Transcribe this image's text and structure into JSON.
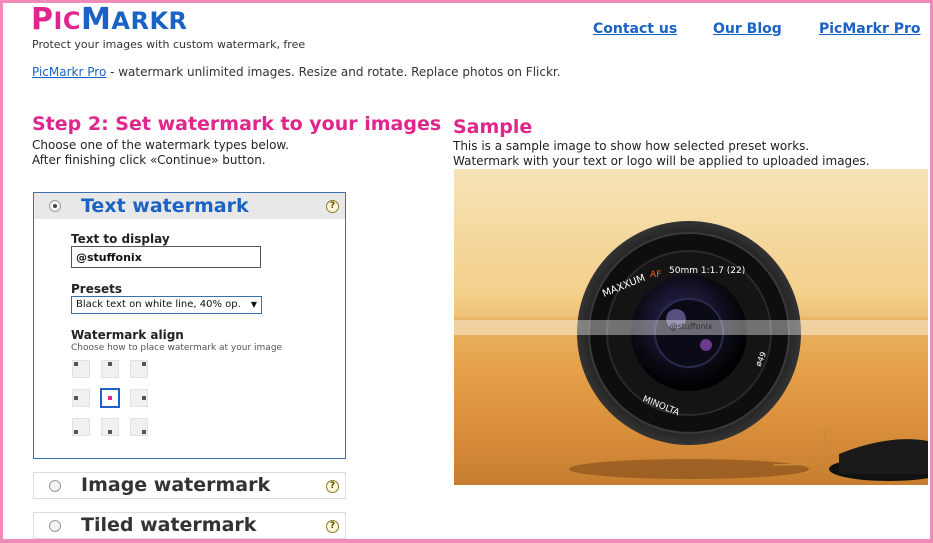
{
  "header": {
    "logo_first": "P",
    "logo_first_small": "IC",
    "logo_second": "M",
    "logo_second_small": "ARKR",
    "tagline": "Protect your images with custom watermark, free",
    "nav": [
      "Contact us",
      "Our Blog",
      "PicMarkr Pro"
    ]
  },
  "promo": {
    "link": "PicMarkr Pro",
    "text": " - watermark unlimited images. Resize and rotate. Replace photos on Flickr."
  },
  "step": {
    "title": "Step 2: Set watermark to your images",
    "line1": "Choose one of the watermark types below.",
    "line2": "After finishing click «Continue» button."
  },
  "text_watermark": {
    "title": "Text watermark",
    "help": "?",
    "text_label": "Text to display",
    "text_value": "@stuffonix",
    "presets_label": "Presets",
    "preset_selected": "Black text on white line, 40% op.",
    "align_label": "Watermark align",
    "align_hint": "Choose how to place watermark at your image",
    "selected_align": "middle-center"
  },
  "image_watermark": {
    "title": "Image watermark",
    "help": "?"
  },
  "tiled_watermark": {
    "title": "Tiled watermark",
    "help": "?"
  },
  "sample": {
    "title": "Sample",
    "line1": "This is a sample image to show how selected preset works.",
    "line2": "Watermark with your text or logo will be applied to uploaded images.",
    "watermark_text": "@stuffonix",
    "lens_text_1": "MAXXUM",
    "lens_text_2": "AF",
    "lens_text_3": "50mm 1:1.7 (22)",
    "lens_text_4": "MINOLTA",
    "lens_text_5": "ø49"
  },
  "colors": {
    "brand_pink": "#e0268c",
    "brand_blue": "#1a62c4",
    "frame": "#f08ab8"
  },
  "icons": [
    "radio-icon",
    "help-icon",
    "select-arrow-icon"
  ]
}
